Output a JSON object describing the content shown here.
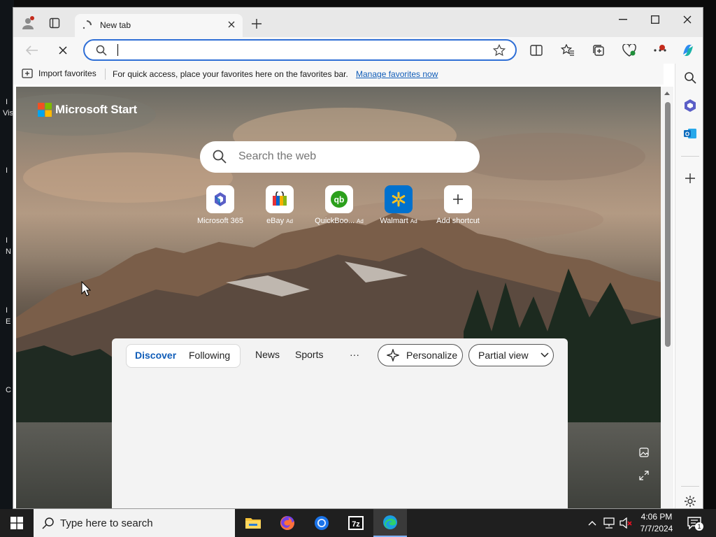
{
  "tab": {
    "title": "New tab"
  },
  "addressbar": {
    "value": "",
    "placeholder": ""
  },
  "favorites_bar": {
    "import_label": "Import favorites",
    "message": "For quick access, place your favorites here on the favorites bar.",
    "manage_link": "Manage favorites now"
  },
  "newtab": {
    "brand": "Microsoft Start",
    "search_placeholder": "Search the web",
    "shortcuts": [
      {
        "label": "Microsoft 365",
        "ad": ""
      },
      {
        "label": "eBay",
        "ad": "Ad"
      },
      {
        "label": "QuickBoo...",
        "ad": "Ad"
      },
      {
        "label": "Walmart",
        "ad": "Ad"
      },
      {
        "label": "Add shortcut",
        "ad": ""
      }
    ],
    "feed": {
      "tabs": [
        "Discover",
        "Following"
      ],
      "links": [
        "News",
        "Sports"
      ],
      "more": "···",
      "personalize": "Personalize",
      "view": "Partial view"
    }
  },
  "desktop_letters": [
    "I",
    "Vis",
    "I",
    "I",
    "N",
    "I",
    "E",
    "C"
  ],
  "taskbar": {
    "search_placeholder": "Type here to search",
    "apps": [
      "file-explorer",
      "firefox",
      "chrome",
      "7zip",
      "edge"
    ],
    "clock_time": "4:06 PM",
    "clock_date": "7/7/2024",
    "notification_count": "1"
  },
  "colors": {
    "accent": "#2f6fd6",
    "link": "#0f5cb8",
    "taskbar": "#1f1f1f"
  }
}
